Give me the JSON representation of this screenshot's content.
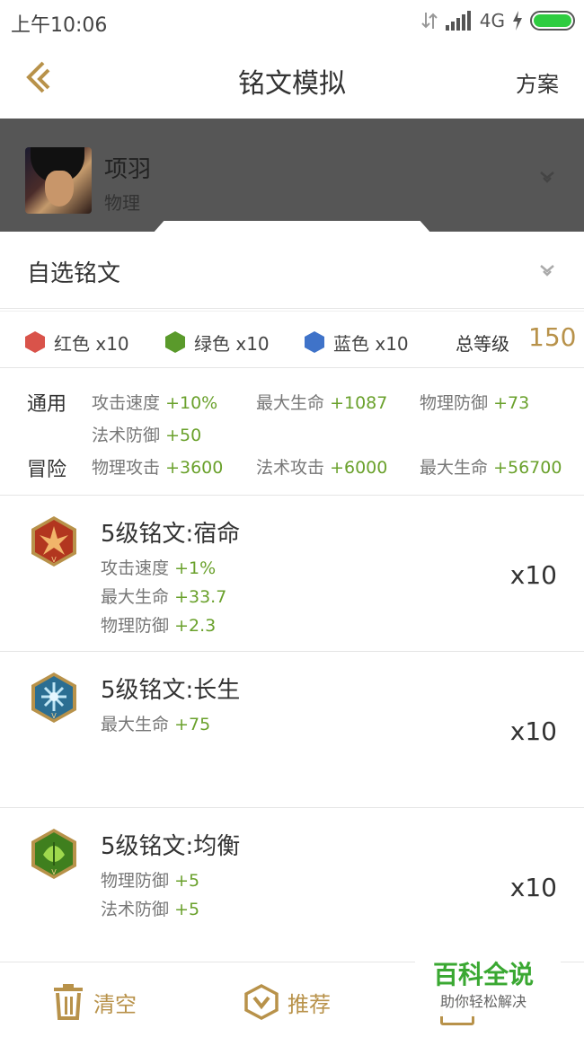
{
  "status_bar": {
    "time": "上午10:06",
    "network": "4G",
    "colors": {
      "battery": "#2ecc40"
    }
  },
  "header": {
    "title": "铭文模拟",
    "right_action": "方案"
  },
  "hero": {
    "name": "项羽",
    "type": "物理"
  },
  "self_select": {
    "label": "自选铭文"
  },
  "colors_summary": {
    "red": "红色 x10",
    "green": "绿色 x10",
    "blue": "蓝色 x10",
    "total_label": "总等级",
    "total_value": "150"
  },
  "stats": {
    "general": {
      "label": "通用",
      "items": [
        {
          "name": "攻击速度",
          "value": "+10%"
        },
        {
          "name": "最大生命",
          "value": "+1087"
        },
        {
          "name": "物理防御",
          "value": "+73"
        },
        {
          "name": "法术防御",
          "value": "+50"
        }
      ]
    },
    "adventure": {
      "label": "冒险",
      "items": [
        {
          "name": "物理攻击",
          "value": "+3600"
        },
        {
          "name": "法术攻击",
          "value": "+6000"
        },
        {
          "name": "最大生命",
          "value": "+56700"
        }
      ]
    }
  },
  "runes": [
    {
      "title": "5级铭文:宿命",
      "count": "x10",
      "color": "red",
      "attrs": [
        {
          "name": "攻击速度",
          "value": "+1%"
        },
        {
          "name": "最大生命",
          "value": "+33.7"
        },
        {
          "name": "物理防御",
          "value": "+2.3"
        }
      ]
    },
    {
      "title": "5级铭文:长生",
      "count": "x10",
      "color": "blue",
      "attrs": [
        {
          "name": "最大生命",
          "value": "+75"
        }
      ]
    },
    {
      "title": "5级铭文:均衡",
      "count": "x10",
      "color": "green",
      "attrs": [
        {
          "name": "物理防御",
          "value": "+5"
        },
        {
          "name": "法术防御",
          "value": "+5"
        }
      ]
    }
  ],
  "bottom_bar": {
    "clear_label": "清空",
    "recommend_label": "推荐"
  },
  "watermark": {
    "title": "百科全说",
    "subtitle": "助你轻松解决"
  },
  "theme": {
    "accent": "#b8924a",
    "value_green": "#6aa12c",
    "hero_bg": "#565656"
  }
}
